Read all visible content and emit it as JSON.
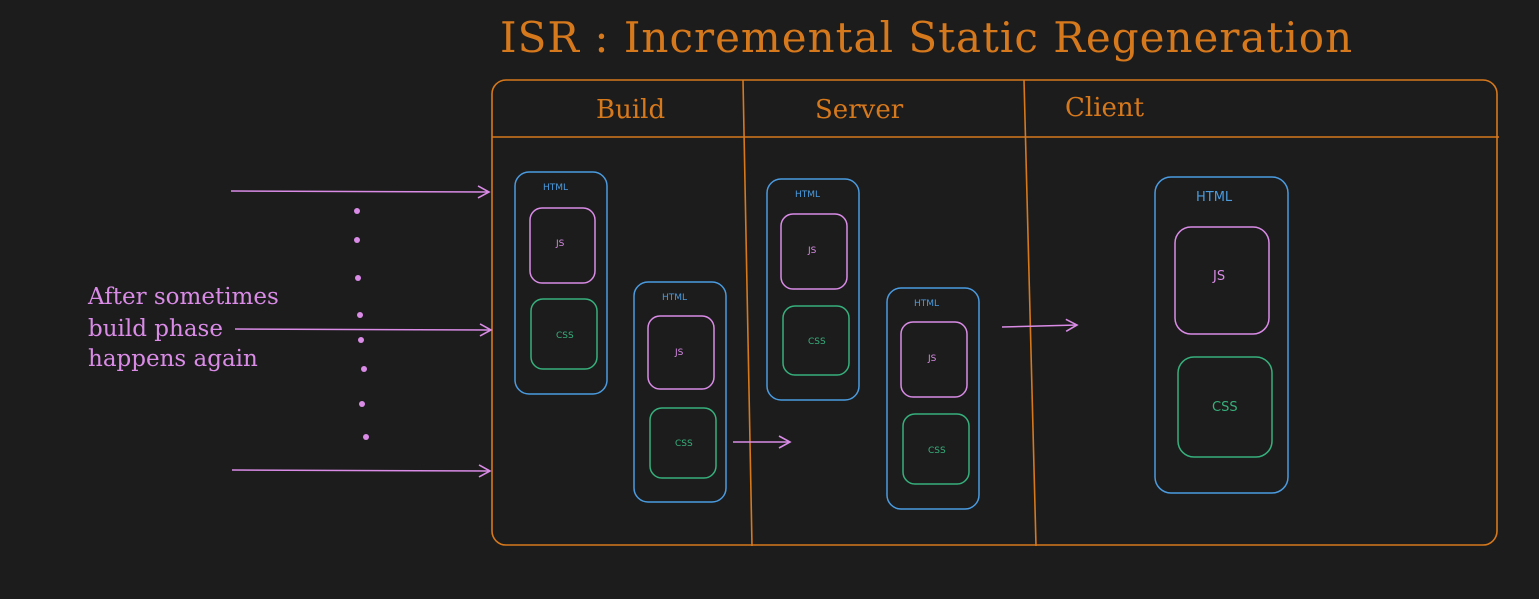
{
  "title": "ISR : Incremental Static Regeneration",
  "columns": {
    "build": "Build",
    "server": "Server",
    "client": "Client"
  },
  "labels": {
    "html": "HTML",
    "js": "JS",
    "css": "CSS"
  },
  "note": {
    "line1": "After sometimes",
    "line2": "build phase",
    "line3": "happens again"
  },
  "colors": {
    "background": "#1c1c1c",
    "frame": "#d6781c",
    "html_box": "#4a9be0",
    "js_box": "#d98be6",
    "css_box": "#36b07c",
    "arrow": "#d98be6"
  }
}
